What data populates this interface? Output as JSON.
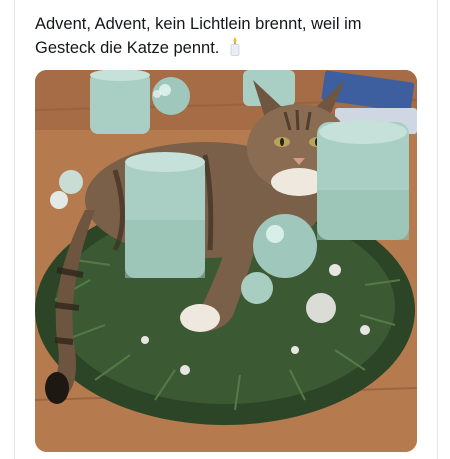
{
  "post": {
    "text_line1": "Advent, Advent, kein Lichtlein brennt, weil im",
    "text_line2": "Gesteck die Katze pennt.",
    "emoji": "candle-emoji"
  },
  "media": {
    "subject": "cat-sleeping-in-advent-wreath",
    "colors": {
      "table": "#b67a4f",
      "pine": "#2f4a2a",
      "candle": "#a9cfc4",
      "cat_fur": "#7a6048",
      "cat_white": "#efe8de"
    }
  }
}
